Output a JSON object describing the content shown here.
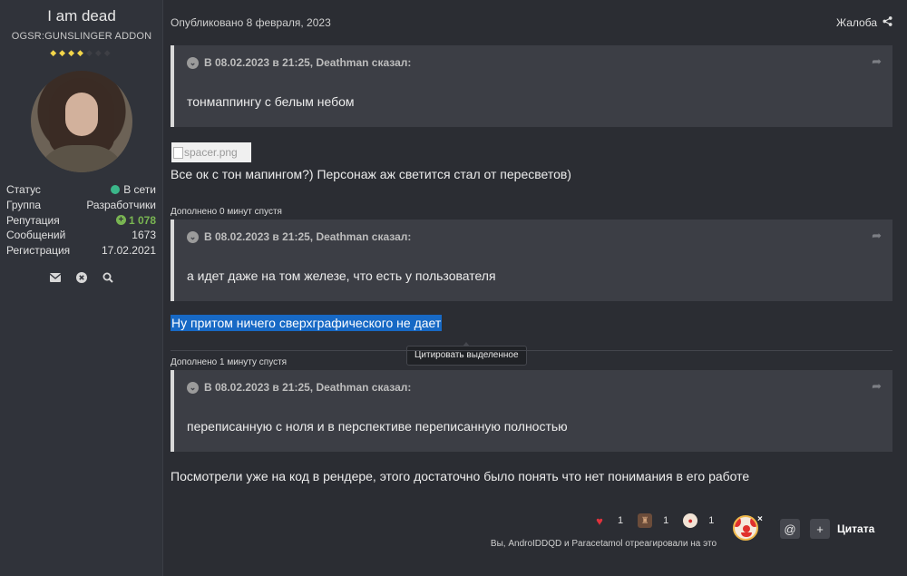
{
  "author": {
    "name": "I am dead",
    "title": "OGSR:GUNSLINGER ADDON",
    "rank_on": "◆◆◆◆",
    "rank_off": "◆◆◆",
    "stats": [
      {
        "label": "Статус",
        "value": "В сети"
      },
      {
        "label": "Группа",
        "value": "Разработчики"
      },
      {
        "label": "Репутация",
        "value": "1 078"
      },
      {
        "label": "Сообщений",
        "value": "1673"
      },
      {
        "label": "Регистрация",
        "value": "17.02.2021"
      }
    ],
    "icons": [
      "envelope-icon",
      "ignore-icon",
      "search-icon"
    ]
  },
  "post": {
    "published": "Опубликовано 8 февраля, 2023",
    "report": "Жалоба",
    "quotes": [
      {
        "header": "В 08.02.2023 в 21:25, Deathman сказал:",
        "text": "тонмаппингу с белым небом"
      },
      {
        "header": "В 08.02.2023 в 21:25, Deathman сказал:",
        "text": "а идет даже на том железе, что есть у пользователя"
      },
      {
        "header": "В 08.02.2023 в 21:25, Deathman сказал:",
        "text": "переписанную с ноля и в перспективе переписанную полностью"
      }
    ],
    "broken_image_alt": "spacer.png",
    "text1": "Все ок с тон мапингом?) Персонаж аж светится стал от пересветов)",
    "added1": "Дополнено 0 минут спустя",
    "selected_text": "Ну притом ничего сверхграфического не дает",
    "tooltip": "Цитировать выделенное",
    "added2": "Дополнено 1 минуту спустя",
    "text3": "Посмотрели уже на код в рендере, этого достаточно было понять что нет понимания в его работе"
  },
  "reactions": {
    "items": [
      {
        "icon": "heart-icon",
        "count": "1"
      },
      {
        "icon": "statue-icon",
        "count": "1"
      },
      {
        "icon": "clown-icon",
        "count": "1"
      }
    ],
    "summary": "Вы, AndroIDDQD и Paracetamol отреагировали на это",
    "close": "×",
    "mention": "@",
    "plus": "+",
    "quote_label": "Цитата"
  },
  "colors": {
    "selection": "#1769c5",
    "online": "#3bb78a",
    "reputation": "#79b552",
    "rank": "#f3d64a"
  }
}
